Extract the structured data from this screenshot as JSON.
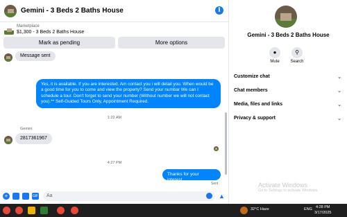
{
  "header": {
    "title": "Gemini - 3 Beds 2 Baths House"
  },
  "listing": {
    "label": "Marketplace",
    "title": "$1,300 - 3 Beds 2 Baths House"
  },
  "actions": {
    "mark_pending": "Mark as pending",
    "more_options": "More options"
  },
  "messages": {
    "msg1": "Message sent",
    "msg2": "Yes, it is available. If you are interested.  Am contact you i will detail you.  When would be a good time for you to come and view the property? Send your numbar We can I schedule a tour.  Don't forget to send your number (Without number we will not contact you).** Self-Guided Tours Only, Appointment Required.",
    "time1": "1:22 AM",
    "sender": "Gemini",
    "msg3": "2817361967",
    "time2": "4:27 PM",
    "msg4": "Thanks for your interest.",
    "status": "Sent"
  },
  "composer": {
    "placeholder": "Aa"
  },
  "sidebar": {
    "name": "Gemini - 3 Beds 2 Baths House",
    "mute": "Mute",
    "search": "Search",
    "sections": [
      "Customize chat",
      "Chat members",
      "Media, files and links",
      "Privacy & support"
    ]
  },
  "watermark": {
    "title": "Activate Windows",
    "subtitle": "Go to Settings to activate Windows."
  },
  "taskbar": {
    "weather": "32°C  Haze",
    "lang": "ENG",
    "time": "4:28 PM",
    "date": "3/17/2025"
  }
}
